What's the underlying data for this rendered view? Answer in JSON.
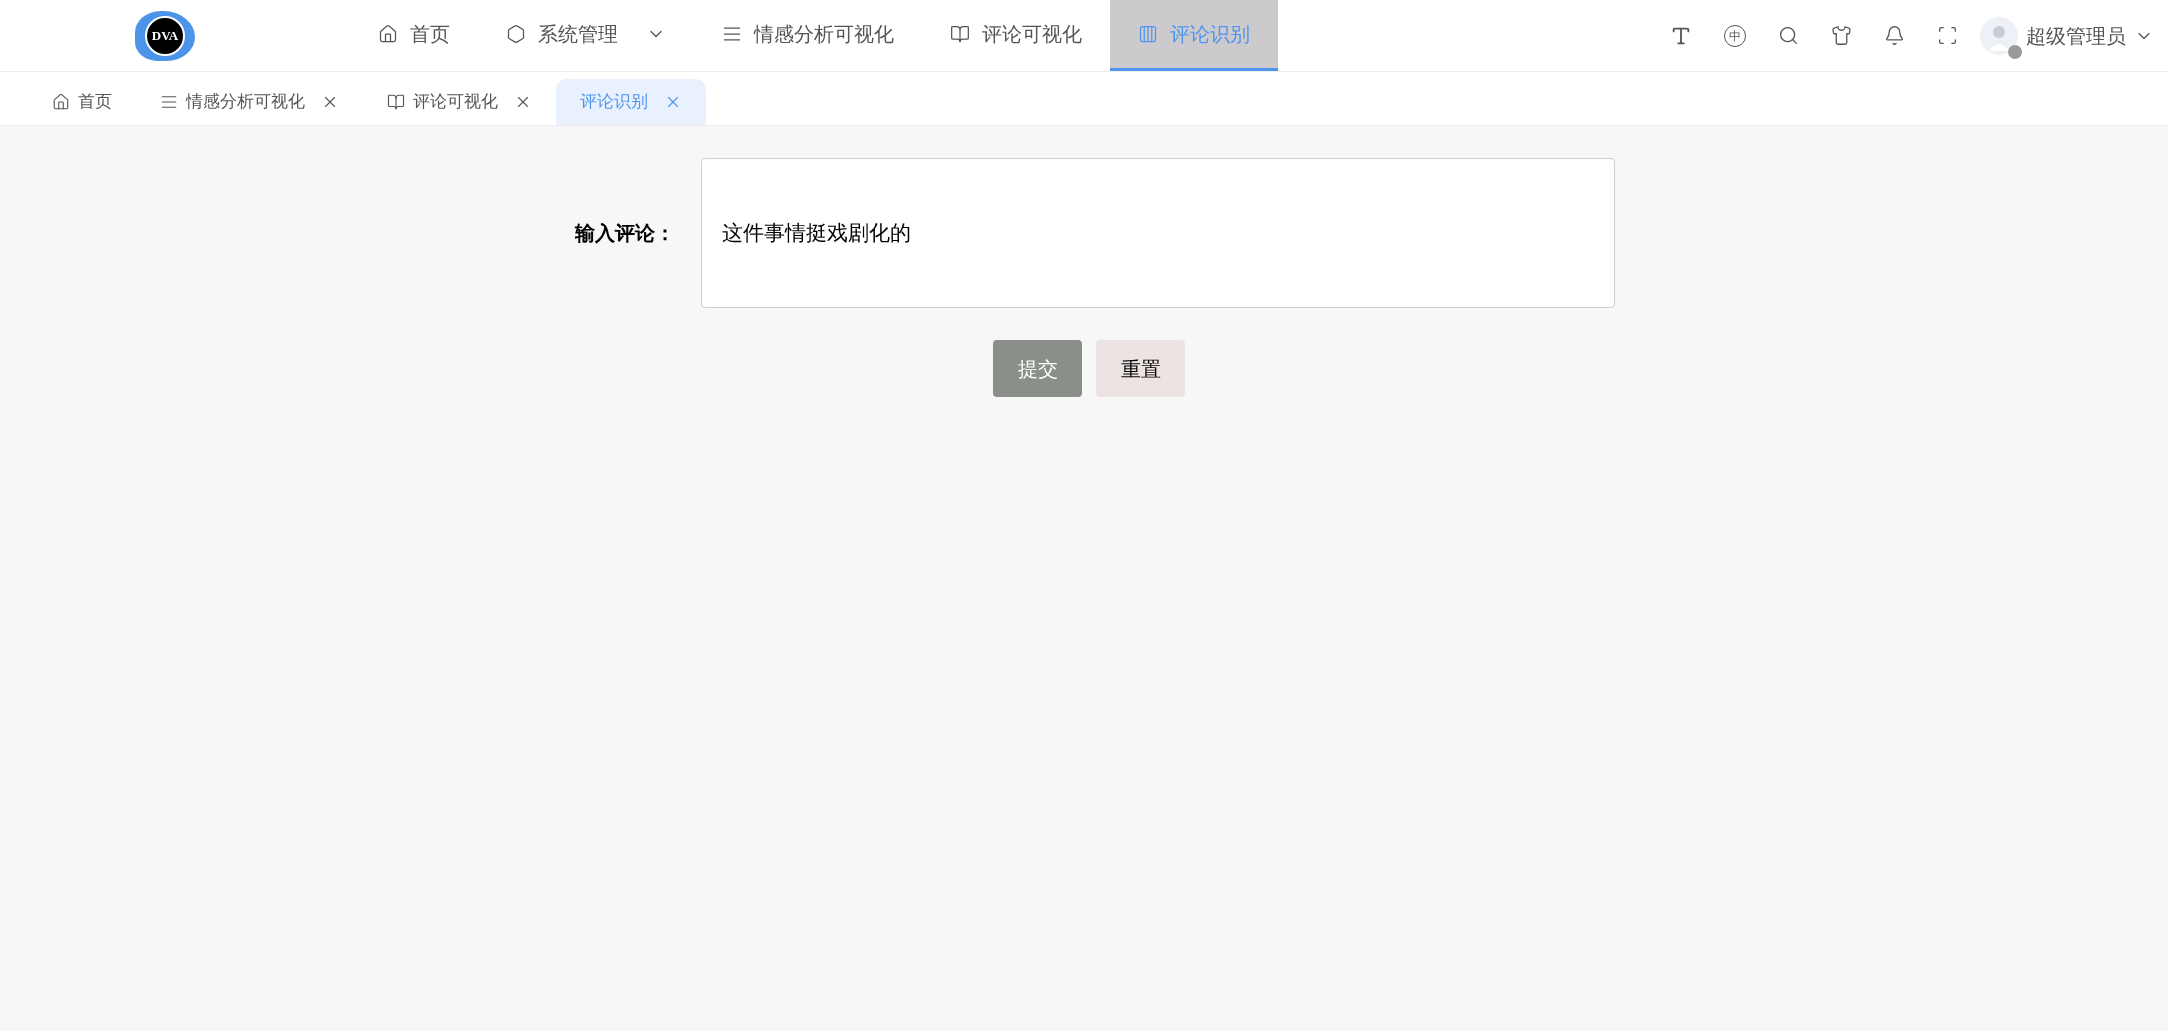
{
  "logo": {
    "text": "DVA"
  },
  "nav": [
    {
      "label": "首页",
      "selected": false,
      "has_dropdown": false
    },
    {
      "label": "系统管理",
      "selected": false,
      "has_dropdown": true
    },
    {
      "label": "情感分析可视化",
      "selected": false,
      "has_dropdown": false
    },
    {
      "label": "评论可视化",
      "selected": false,
      "has_dropdown": false
    },
    {
      "label": "评论识别",
      "selected": true,
      "has_dropdown": false
    }
  ],
  "toolbar": {
    "language_glyph": "中"
  },
  "user": {
    "name": "超级管理员",
    "online": false
  },
  "tabs": [
    {
      "label": "首页",
      "selected": false,
      "closable": false
    },
    {
      "label": "情感分析可视化",
      "selected": false,
      "closable": true
    },
    {
      "label": "评论可视化",
      "selected": false,
      "closable": true
    },
    {
      "label": "评论识别",
      "selected": true,
      "closable": true
    }
  ],
  "form": {
    "label": "输入评论：",
    "value": "这件事情挺戏剧化的"
  },
  "buttons": [
    {
      "label": "提交",
      "kind": "primary"
    },
    {
      "label": "重置",
      "kind": "secondary"
    }
  ]
}
